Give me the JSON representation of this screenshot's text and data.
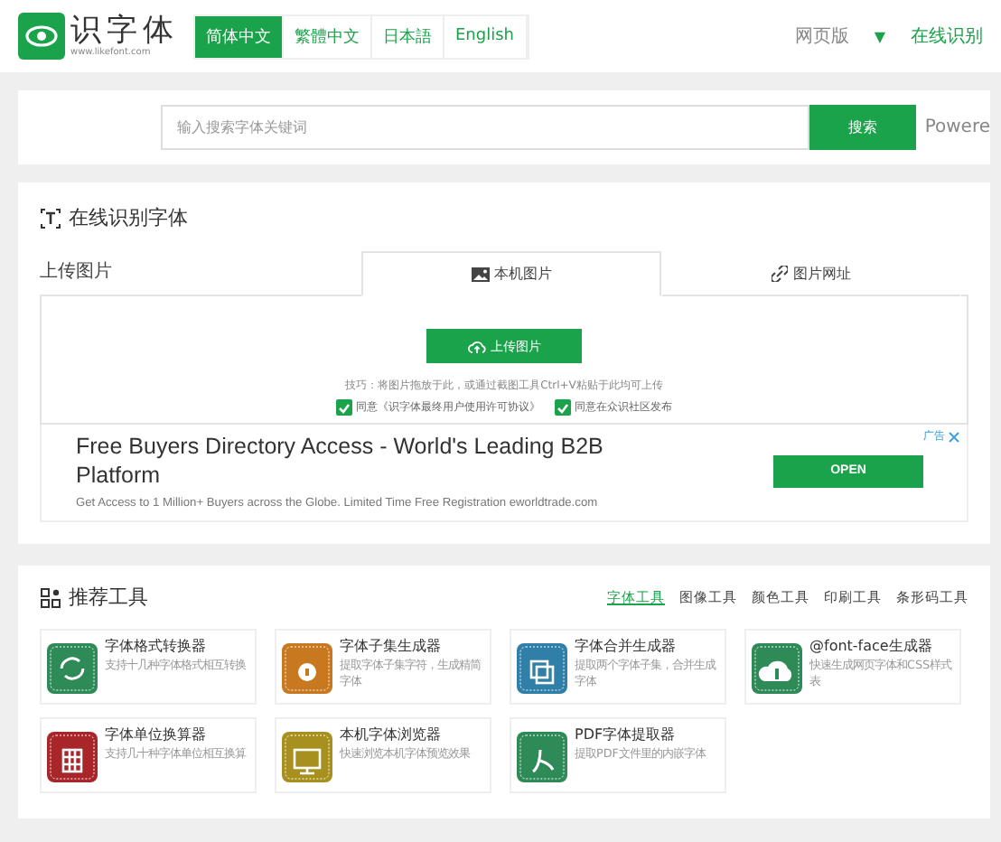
{
  "header": {
    "logo_text": "识字体",
    "logo_url": "www.likefont.com",
    "languages": [
      {
        "label": "简体中文",
        "selected": true
      },
      {
        "label": "繁體中文",
        "selected": false
      },
      {
        "label": "日本語",
        "selected": false
      },
      {
        "label": "English",
        "selected": false
      }
    ],
    "nav": [
      {
        "label": "网页版",
        "kind": "muted"
      },
      {
        "label": "▼",
        "kind": "caret"
      },
      {
        "label": "在线识别",
        "kind": "link"
      }
    ]
  },
  "search": {
    "placeholder": "输入搜索字体关键词",
    "button": "搜索",
    "powered": "Powere"
  },
  "recognize": {
    "title": "在线识别字体",
    "upload_label": "上传图片",
    "tabs": [
      {
        "label": "本机图片",
        "kind": "image",
        "selected": true
      },
      {
        "label": "图片网址",
        "kind": "link",
        "selected": false
      }
    ],
    "upload_button": "上传图片",
    "tip": "技巧：将图片拖放于此，或通过截图工具Ctrl+V粘贴于此均可上传",
    "agreements": [
      {
        "label": "同意《识字体最终用户使用许可协议》",
        "checked": true
      },
      {
        "label": "同意在众识社区发布",
        "checked": true
      }
    ]
  },
  "ad": {
    "headline": "Free Buyers Directory Access - World's Leading B2B Platform",
    "body": "Get Access to 1 Million+ Buyers across the Globe. Limited Time Free Registration eworldtrade.com",
    "badge": "广告",
    "button": "OPEN"
  },
  "tools": {
    "title": "推荐工具",
    "categories": [
      {
        "label": "字体工具",
        "selected": true
      },
      {
        "label": "图像工具",
        "selected": false
      },
      {
        "label": "颜色工具",
        "selected": false
      },
      {
        "label": "印刷工具",
        "selected": false
      },
      {
        "label": "条形码工具",
        "selected": false
      }
    ],
    "items": [
      {
        "name": "字体格式转换器",
        "desc": "支持十几种字体格式相互转换",
        "color": "#2e8b57",
        "kind": "convert"
      },
      {
        "name": "字体子集生成器",
        "desc": "提取字体子集字符，生成精简字体",
        "color": "#c8781e",
        "kind": "subset"
      },
      {
        "name": "字体合并生成器",
        "desc": "提取两个字体子集，合并生成字体",
        "color": "#2f7fa8",
        "kind": "merge"
      },
      {
        "name": "@font-face生成器",
        "desc": "快速生成网页字体和CSS样式表",
        "color": "#2e8b57",
        "kind": "cloud"
      },
      {
        "name": "字体单位换算器",
        "desc": "支持几十种字体单位相互换算",
        "color": "#a8262a",
        "kind": "calc"
      },
      {
        "name": "本机字体浏览器",
        "desc": "快速浏览本机字体预览效果",
        "color": "#a8901e",
        "kind": "monitor"
      },
      {
        "name": "PDF字体提取器",
        "desc": "提取PDF文件里的内嵌字体",
        "color": "#2e8b57",
        "kind": "pdf"
      }
    ]
  }
}
